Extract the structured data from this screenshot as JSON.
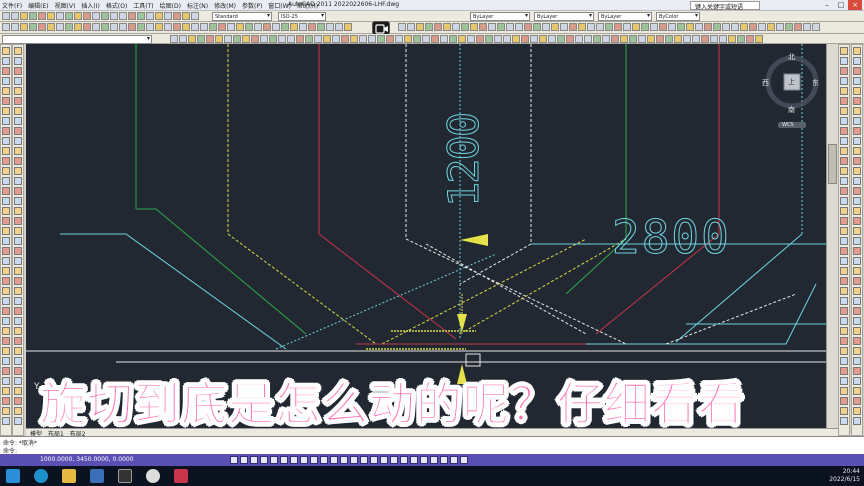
{
  "window": {
    "title": "AutoCAD 2011   2022022606-LHF.dwg",
    "menu": [
      "文件(F)",
      "编辑(E)",
      "视图(V)",
      "插入(I)",
      "格式(O)",
      "工具(T)",
      "绘图(D)",
      "标注(N)",
      "修改(M)",
      "参数(P)",
      "窗口(W)",
      "帮助(H)"
    ],
    "help_field": "键入关键字或短语"
  },
  "toolbar": {
    "style_combo": "Standard",
    "dim_combo": "ISO-25",
    "layer_combo": "ByLayer",
    "linetype_combo": "ByLayer",
    "lineweight_combo": "ByLayer",
    "color_combo": "ByColor"
  },
  "viewcube": {
    "north": "北",
    "west": "西",
    "east": "东",
    "south": "南",
    "top": "上",
    "wcs": "WCS"
  },
  "drawing": {
    "dim_1200": "1200",
    "dim_2800": "2800",
    "axis_y": "Y"
  },
  "tabs": [
    "模型",
    "布局1",
    "布局2"
  ],
  "command": {
    "line1": "命令: *取消*",
    "line2": "命令:"
  },
  "status": {
    "coords": "1000.0000, 3450.0000, 0.0000"
  },
  "taskbar": {
    "time": "20:44",
    "date": "2022/6/15"
  },
  "subtitle": "旋切到底是怎么动的呢？仔细看看",
  "colors": {
    "canvas": "#222831",
    "subtitle": "#ff6fb0",
    "dim_text": "#6fd4e0"
  }
}
